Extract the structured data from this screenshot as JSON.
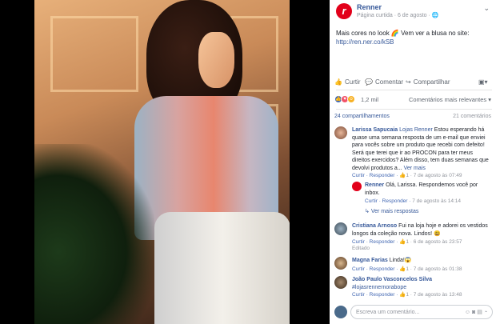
{
  "page": {
    "name": "Renner",
    "subtitle": "Página curtida · 6 de agosto · 🌐",
    "logo_letter": "r",
    "brand_color": "#e2001a"
  },
  "post": {
    "text": "Mais cores no look 🌈 Vem ver a blusa no site:",
    "link": "http://ren.ner.co/kSB"
  },
  "actions": {
    "like": "Curtir",
    "comment": "Comentar",
    "share": "Compartilhar"
  },
  "reactions": {
    "count": "1,2 mil",
    "sort": "Comentários mais relevantes ▾"
  },
  "stats": {
    "shares": "24 compartilhamentos",
    "comments": "21 comentários"
  },
  "comments": [
    {
      "name": "Larissa Sapucaia",
      "mention": "Lojas Renner",
      "text": "Estou esperando há quase uma semana resposta de um e-mail que enviei para vocês sobre um produto que recebi com defeito! Será que terei que ir ao PROCON para ter meus direitos exercidos? Além disso, tem duas semanas que devolvi produtos a...",
      "more": "Ver mais",
      "actions": "Curtir · Responder · ",
      "likes": "1",
      "time": " · 7 de agosto às 07:49"
    },
    {
      "name": "Renner",
      "text": "Olá, Larissa. Respondemos você por inbox.",
      "actions": "Curtir · Responder · ",
      "time": "7 de agosto às 14:14"
    },
    {
      "more_replies": "Ver mais respostas"
    },
    {
      "name": "Cristiana Arnoso",
      "text": "Fui na loja hoje e adorei os vestidos longos da coleção nova. Lindos! 😃",
      "actions": "Curtir · Responder · ",
      "likes": "1",
      "time": " · 6 de agosto às 23:57",
      "edited": "Editado"
    },
    {
      "name": "Magna Farias",
      "text": "Linda!😱",
      "actions": "Curtir · Responder · ",
      "likes": "1",
      "time": " · 7 de agosto às 01:38"
    },
    {
      "name": "João Paulo Vasconcelos Silva",
      "text": "#lojasrennernorabope",
      "actions": "Curtir · Responder · ",
      "likes": "1",
      "time": " · 7 de agosto às 13:48"
    }
  ],
  "composer": {
    "placeholder": "Escreva um comentário..."
  },
  "icons": {
    "like": "thumbs-up-icon",
    "comment": "speech-bubble-icon",
    "share": "share-arrow-icon",
    "camera": "camera-icon",
    "emoji": "emoji-icon",
    "gif": "gif-icon",
    "sticker": "sticker-icon"
  }
}
